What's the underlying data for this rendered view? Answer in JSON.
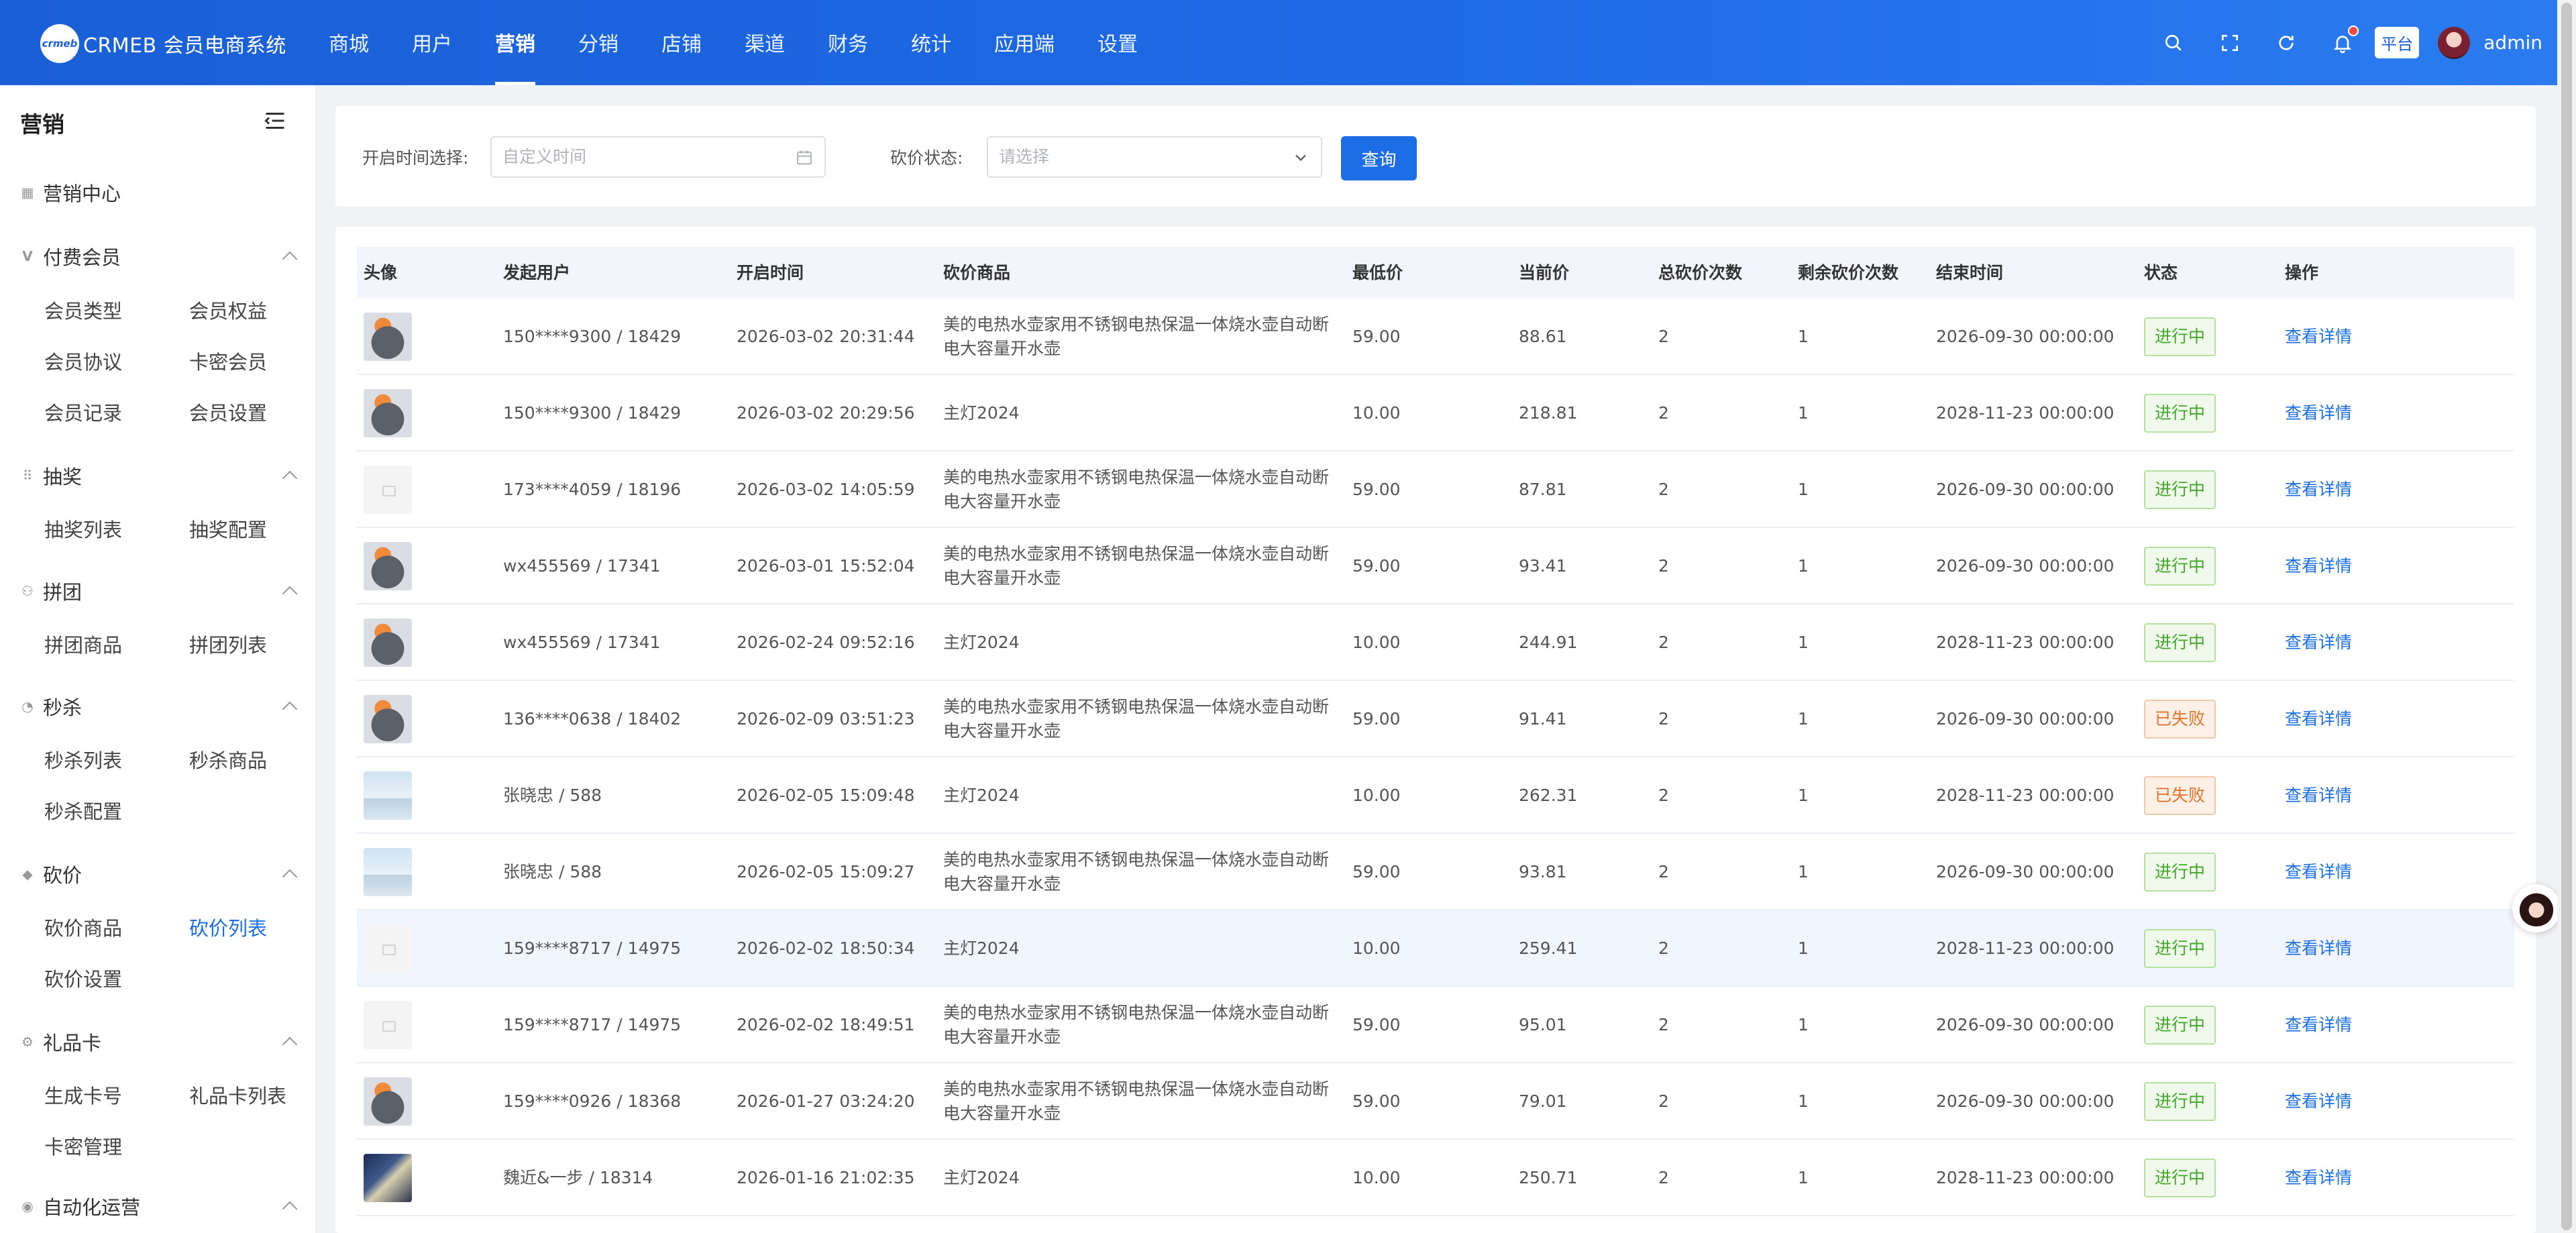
{
  "header": {
    "logo_mark": "crmeb",
    "logo_text": "CRMEB 会员电商系统",
    "nav": [
      "商城",
      "用户",
      "营销",
      "分销",
      "店铺",
      "渠道",
      "财务",
      "统计",
      "应用端",
      "设置"
    ],
    "active_nav": "营销",
    "platform_badge": "平台",
    "admin_name": "admin",
    "accent_color": "#1a5fd6"
  },
  "sidebar": {
    "title": "营销",
    "sections": {
      "center": "营销中心",
      "paid_member": "付费会员",
      "lottery": "抽奖",
      "group": "拼团",
      "seckill": "秒杀",
      "bargain": "砍价",
      "gift_card": "礼品卡",
      "automation": "自动化运营"
    },
    "items": {
      "member_type": "会员类型",
      "member_rights": "会员权益",
      "member_agreement": "会员协议",
      "card_member": "卡密会员",
      "member_record": "会员记录",
      "member_settings": "会员设置",
      "lottery_list": "抽奖列表",
      "lottery_config": "抽奖配置",
      "group_goods": "拼团商品",
      "group_list": "拼团列表",
      "seckill_list": "秒杀列表",
      "seckill_goods": "秒杀商品",
      "seckill_config": "秒杀配置",
      "bargain_goods": "砍价商品",
      "bargain_list": "砍价列表",
      "bargain_settings": "砍价设置",
      "generate_card": "生成卡号",
      "gift_card_list": "礼品卡列表",
      "card_manage": "卡密管理"
    },
    "active_item": "砍价列表"
  },
  "filter": {
    "time_label": "开启时间选择:",
    "time_placeholder": "自定义时间",
    "status_label": "砍价状态:",
    "status_placeholder": "请选择",
    "query_button": "查询"
  },
  "table": {
    "columns": [
      "头像",
      "发起用户",
      "开启时间",
      "砍价商品",
      "最低价",
      "当前价",
      "总砍价次数",
      "剩余砍价次数",
      "结束时间",
      "状态",
      "操作"
    ],
    "rows": [
      {
        "avatar": "cat",
        "user": "150****9300 / 18429",
        "start": "2026-03-02 20:31:44",
        "goods": "美的电热水壶家用不锈钢电热保温一体烧水壶自动断电大容量开水壶",
        "min": "59.00",
        "current": "88.61",
        "total": "2",
        "remain": "1",
        "end": "2026-09-30 00:00:00",
        "status": "进行中",
        "status_type": "ok",
        "action": "查看详情"
      },
      {
        "avatar": "cat",
        "user": "150****9300 / 18429",
        "start": "2026-03-02 20:29:56",
        "goods": "主灯2024",
        "min": "10.00",
        "current": "218.81",
        "total": "2",
        "remain": "1",
        "end": "2028-11-23 00:00:00",
        "status": "进行中",
        "status_type": "ok",
        "action": "查看详情"
      },
      {
        "avatar": "blank",
        "user": "173****4059 / 18196",
        "start": "2026-03-02 14:05:59",
        "goods": "美的电热水壶家用不锈钢电热保温一体烧水壶自动断电大容量开水壶",
        "min": "59.00",
        "current": "87.81",
        "total": "2",
        "remain": "1",
        "end": "2026-09-30 00:00:00",
        "status": "进行中",
        "status_type": "ok",
        "action": "查看详情"
      },
      {
        "avatar": "cat",
        "user": "wx455569 / 17341",
        "start": "2026-03-01 15:52:04",
        "goods": "美的电热水壶家用不锈钢电热保温一体烧水壶自动断电大容量开水壶",
        "min": "59.00",
        "current": "93.41",
        "total": "2",
        "remain": "1",
        "end": "2026-09-30 00:00:00",
        "status": "进行中",
        "status_type": "ok",
        "action": "查看详情"
      },
      {
        "avatar": "cat",
        "user": "wx455569 / 17341",
        "start": "2026-02-24 09:52:16",
        "goods": "主灯2024",
        "min": "10.00",
        "current": "244.91",
        "total": "2",
        "remain": "1",
        "end": "2028-11-23 00:00:00",
        "status": "进行中",
        "status_type": "ok",
        "action": "查看详情"
      },
      {
        "avatar": "cat",
        "user": "136****0638 / 18402",
        "start": "2026-02-09 03:51:23",
        "goods": "美的电热水壶家用不锈钢电热保温一体烧水壶自动断电大容量开水壶",
        "min": "59.00",
        "current": "91.41",
        "total": "2",
        "remain": "1",
        "end": "2026-09-30 00:00:00",
        "status": "已失败",
        "status_type": "fail",
        "action": "查看详情"
      },
      {
        "avatar": "scene",
        "user": "张晓忠 / 588",
        "start": "2026-02-05 15:09:48",
        "goods": "主灯2024",
        "min": "10.00",
        "current": "262.31",
        "total": "2",
        "remain": "1",
        "end": "2028-11-23 00:00:00",
        "status": "已失败",
        "status_type": "fail",
        "action": "查看详情"
      },
      {
        "avatar": "scene",
        "user": "张晓忠 / 588",
        "start": "2026-02-05 15:09:27",
        "goods": "美的电热水壶家用不锈钢电热保温一体烧水壶自动断电大容量开水壶",
        "min": "59.00",
        "current": "93.81",
        "total": "2",
        "remain": "1",
        "end": "2026-09-30 00:00:00",
        "status": "进行中",
        "status_type": "ok",
        "action": "查看详情"
      },
      {
        "avatar": "blank",
        "user": "159****8717 / 14975",
        "start": "2026-02-02 18:50:34",
        "goods": "主灯2024",
        "min": "10.00",
        "current": "259.41",
        "total": "2",
        "remain": "1",
        "end": "2028-11-23 00:00:00",
        "status": "进行中",
        "status_type": "ok",
        "action": "查看详情"
      },
      {
        "avatar": "blank",
        "user": "159****8717 / 14975",
        "start": "2026-02-02 18:49:51",
        "goods": "美的电热水壶家用不锈钢电热保温一体烧水壶自动断电大容量开水壶",
        "min": "59.00",
        "current": "95.01",
        "total": "2",
        "remain": "1",
        "end": "2026-09-30 00:00:00",
        "status": "进行中",
        "status_type": "ok",
        "action": "查看详情"
      },
      {
        "avatar": "cat",
        "user": "159****0926 / 18368",
        "start": "2026-01-27 03:24:20",
        "goods": "美的电热水壶家用不锈钢电热保温一体烧水壶自动断电大容量开水壶",
        "min": "59.00",
        "current": "79.01",
        "total": "2",
        "remain": "1",
        "end": "2026-09-30 00:00:00",
        "status": "进行中",
        "status_type": "ok",
        "action": "查看详情"
      },
      {
        "avatar": "anime",
        "user": "魏近&一步 / 18314",
        "start": "2026-01-16 21:02:35",
        "goods": "主灯2024",
        "min": "10.00",
        "current": "250.71",
        "total": "2",
        "remain": "1",
        "end": "2028-11-23 00:00:00",
        "status": "进行中",
        "status_type": "ok",
        "action": "查看详情"
      }
    ],
    "highlighted_row": 8
  }
}
